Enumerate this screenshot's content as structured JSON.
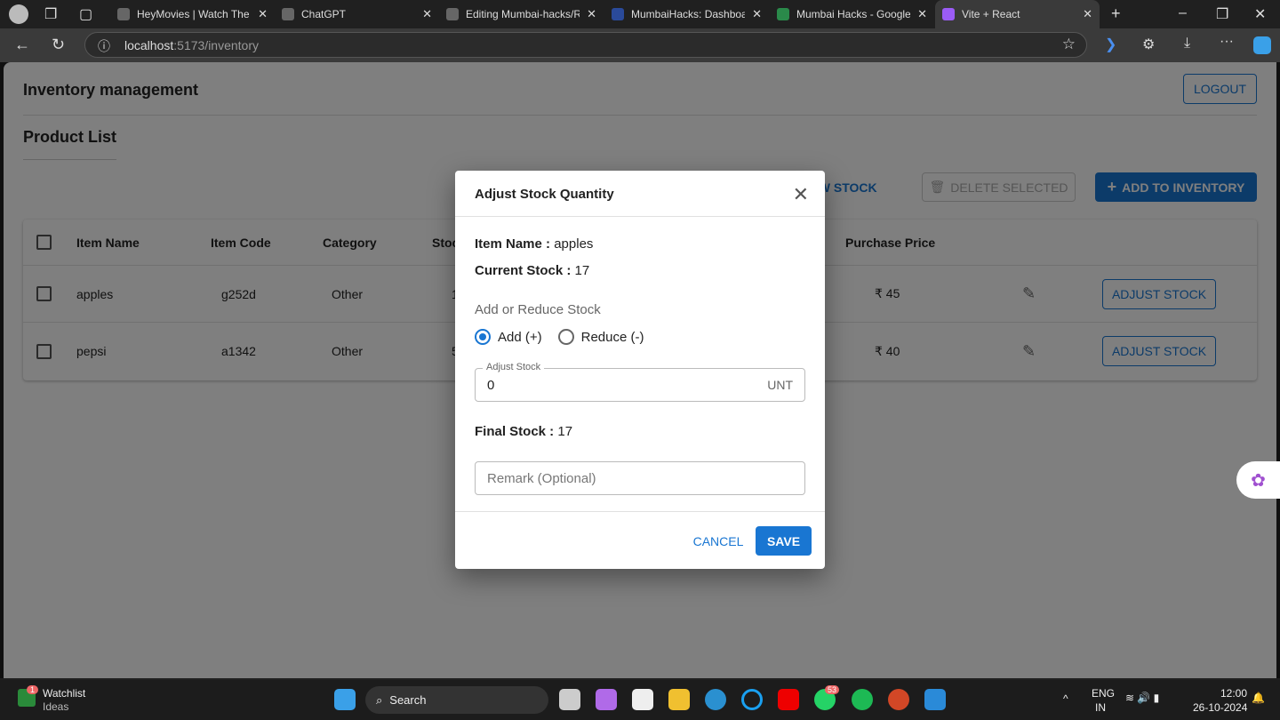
{
  "browser": {
    "tabs": [
      {
        "title": "HeyMovies | Watch The H"
      },
      {
        "title": "ChatGPT"
      },
      {
        "title": "Editing Mumbai-hacks/RE"
      },
      {
        "title": "MumbaiHacks: Dashboard"
      },
      {
        "title": "Mumbai Hacks - Google D"
      },
      {
        "title": "Vite + React"
      }
    ],
    "url_host": "localhost",
    "url_path": ":5173/inventory"
  },
  "app": {
    "title": "Inventory management",
    "logout": "LOGOUT",
    "section": "Product List",
    "low_stock": "LOW STOCK",
    "delete_selected": "DELETE SELECTED",
    "add_to_inventory": "ADD TO INVENTORY",
    "columns": [
      "Item Name",
      "Item Code",
      "Category",
      "Stock",
      "Purchase Price"
    ],
    "rows": [
      {
        "name": "apples",
        "code": "g252d",
        "category": "Other",
        "stock": "17",
        "price": "₹ 45",
        "action": "ADJUST STOCK"
      },
      {
        "name": "pepsi",
        "code": "a1342",
        "category": "Other",
        "stock": "5",
        "price": "₹ 40",
        "action": "ADJUST STOCK"
      }
    ]
  },
  "modal": {
    "title": "Adjust Stock Quantity",
    "item_label": "Item Name :",
    "item_value": "apples",
    "current_label": "Current Stock :",
    "current_value": "17",
    "mode_label": "Add or Reduce Stock",
    "add": "Add (+)",
    "reduce": "Reduce (-)",
    "selected": "add",
    "adjust_label": "Adjust Stock",
    "adjust_value": "0",
    "unit": "UNT",
    "final_label": "Final Stock :",
    "final_value": "17",
    "remark_placeholder": "Remark (Optional)",
    "cancel": "CANCEL",
    "save": "SAVE"
  },
  "taskbar": {
    "watchlist": "Watchlist",
    "ideas": "Ideas",
    "watch_badge": "1",
    "search": "Search",
    "whatsapp_badge": "53",
    "lang1": "ENG",
    "lang2": "IN",
    "time": "12:00",
    "date": "26-10-2024"
  },
  "colors": {
    "primary": "#1976d2"
  }
}
